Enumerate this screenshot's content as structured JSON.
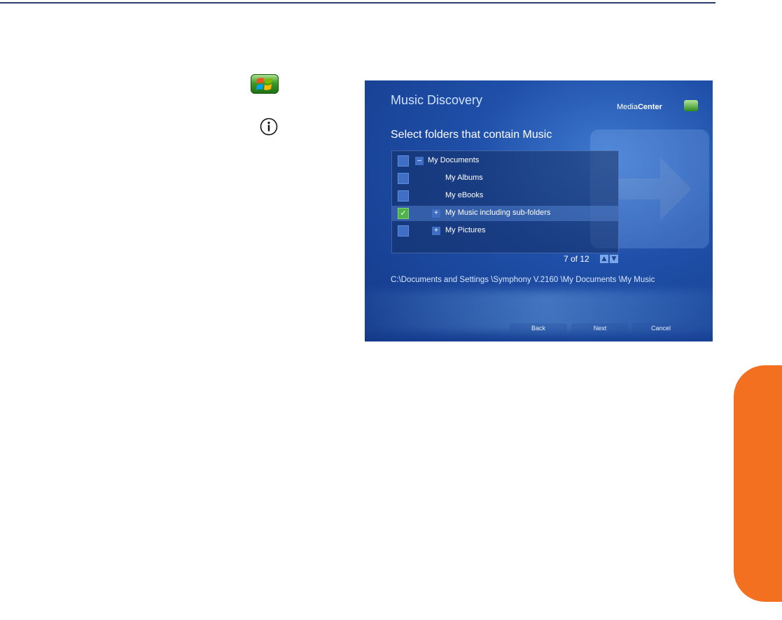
{
  "screen": {
    "window_title": "Music Discovery",
    "brand_prefix": "Media",
    "brand_suffix": "Center",
    "heading": "Select folders that contain Music",
    "folders": [
      {
        "label": "My Documents",
        "checked": false,
        "expander": "–"
      },
      {
        "label": "My Albums",
        "checked": false
      },
      {
        "label": "My eBooks",
        "checked": false
      },
      {
        "label": "My Music including sub-folders",
        "checked": true,
        "expander": "+"
      },
      {
        "label": "My Pictures",
        "checked": false,
        "expander": "+"
      }
    ],
    "pager": "7 of 12",
    "path": "C:\\Documents and Settings \\Symphony V.2160 \\My Documents \\My Music",
    "buttons": {
      "back": "Back",
      "next": "Next",
      "cancel": "Cancel"
    }
  },
  "icons": {
    "start": "windows-start-icon",
    "info": "info-icon"
  },
  "colors": {
    "accent_orange": "#f37021",
    "rule_navy": "#2b3a6b",
    "screen_blue": "#1f4fa8"
  }
}
